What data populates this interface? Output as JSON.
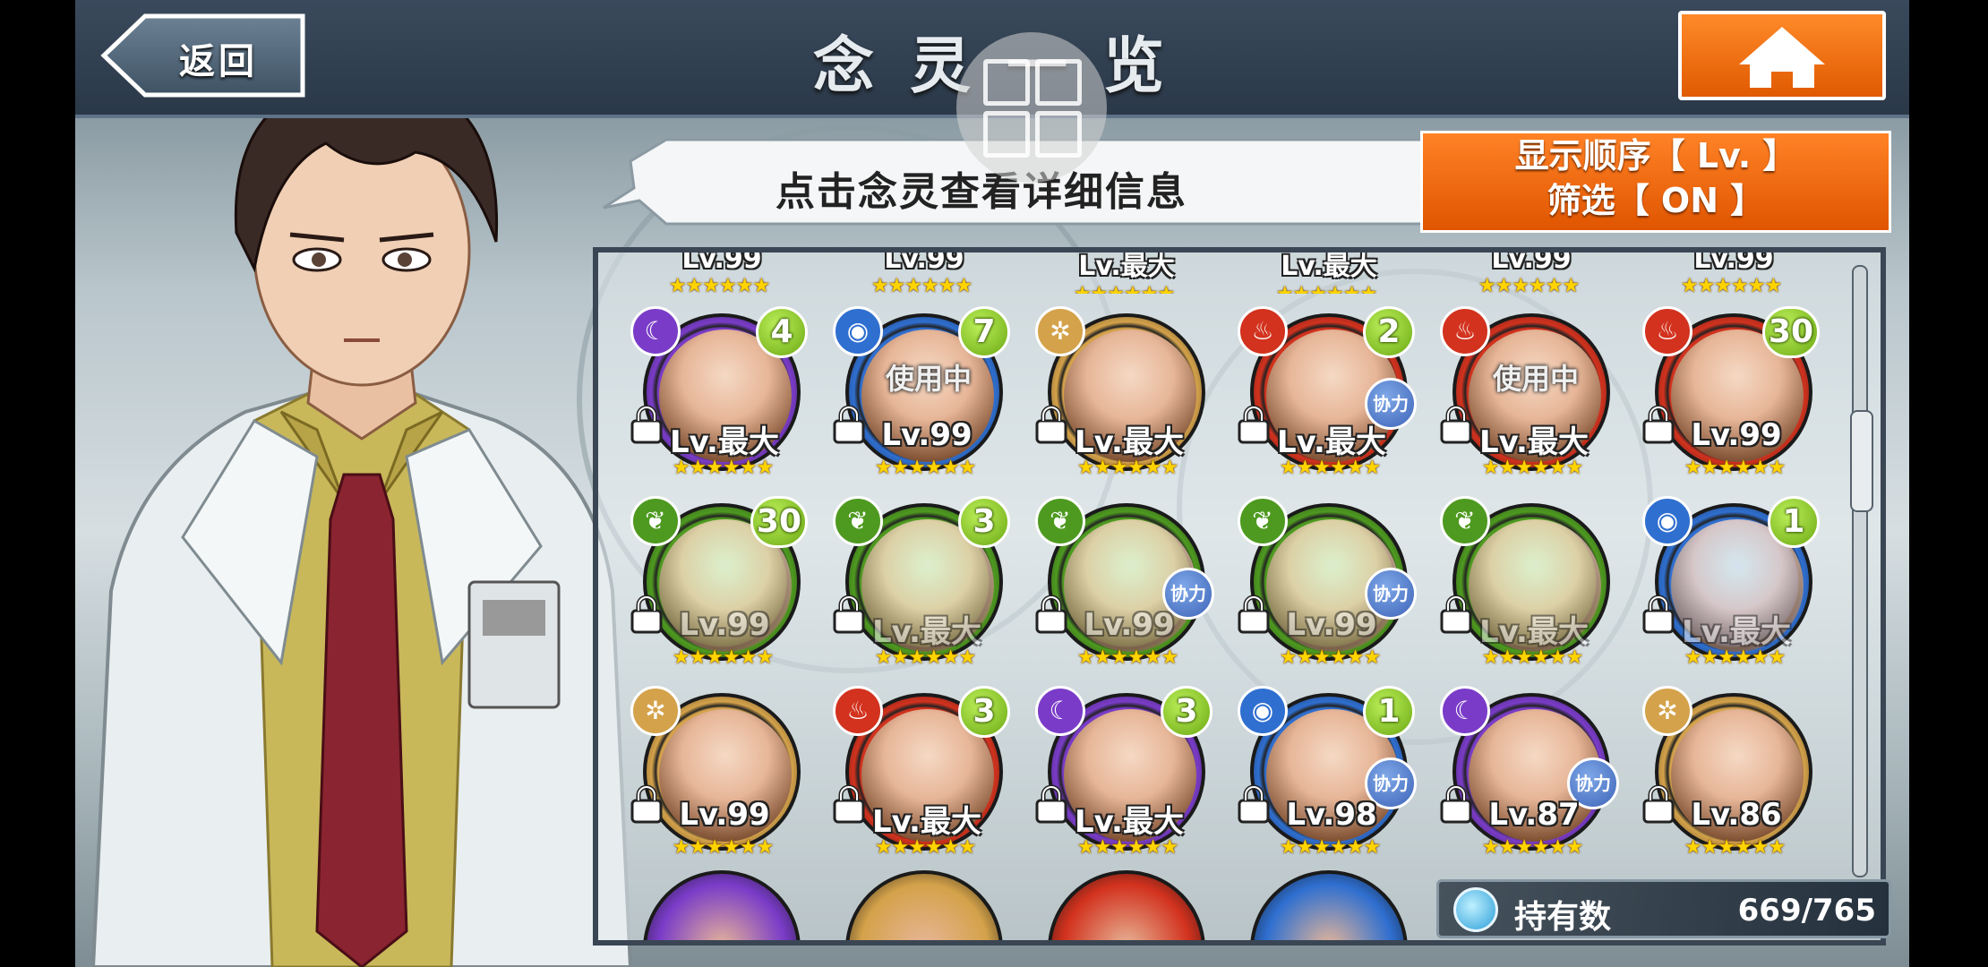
{
  "topbar": {
    "back_label": "返回",
    "title": "念灵一览"
  },
  "hint": "点击念灵查看详细信息",
  "sort_button": {
    "line1": "显示顺序【 Lv. 】",
    "line2": "筛选【 ON 】"
  },
  "owned": {
    "label": "持有数",
    "value": "669/765"
  },
  "colors": {
    "orange": "#e86400",
    "moon": "#7a3cc8",
    "water": "#2f6fd0",
    "light": "#d4a24a",
    "fire": "#d2321e",
    "wood": "#4e9a20",
    "count_badge": "#8ac820"
  },
  "partial_top_row": [
    "Lv.99",
    "Lv.99",
    "Lv.最大",
    "Lv.最大",
    "Lv.99",
    "Lv.99"
  ],
  "rows": [
    [
      {
        "element": "moon",
        "count": "4",
        "level": "Lv.最大",
        "stars": "★★★★★★"
      },
      {
        "element": "water",
        "count": "7",
        "level": "Lv.99",
        "stars": "★★★★★★",
        "status": "使用中"
      },
      {
        "element": "light",
        "level": "Lv.最大",
        "stars": "★★★★★★"
      },
      {
        "element": "fire",
        "count": "2",
        "level": "Lv.最大",
        "stars": "★★★★★★",
        "assist": "协力"
      },
      {
        "element": "fire",
        "level": "Lv.最大",
        "stars": "★★★★★★",
        "status": "使用中"
      },
      {
        "element": "fire",
        "count": "30",
        "level": "Lv.99",
        "stars": "★★★★★★"
      }
    ],
    [
      {
        "element": "wood",
        "count": "30",
        "level": "Lv.99",
        "stars": "★★★★★★",
        "faded": true
      },
      {
        "element": "wood",
        "count": "3",
        "level": "Lv.最大",
        "stars": "★★★★★★",
        "faded": true
      },
      {
        "element": "wood",
        "level": "Lv.99",
        "stars": "★★★★★★",
        "faded": true,
        "assist": "协力"
      },
      {
        "element": "wood",
        "level": "Lv.99",
        "stars": "★★★★★★",
        "faded": true,
        "assist": "协力"
      },
      {
        "element": "wood",
        "level": "Lv.最大",
        "stars": "★★★★★★",
        "faded": true
      },
      {
        "element": "water",
        "count": "1",
        "level": "Lv.最大",
        "stars": "★★★★★★",
        "faded": true
      }
    ],
    [
      {
        "element": "light",
        "level": "Lv.99",
        "stars": "★★★★★★"
      },
      {
        "element": "fire",
        "count": "3",
        "level": "Lv.最大",
        "stars": "★★★★★★"
      },
      {
        "element": "moon",
        "count": "3",
        "level": "Lv.最大",
        "stars": "★★★★★★"
      },
      {
        "element": "water",
        "count": "1",
        "level": "Lv.98",
        "stars": "★★★★★★",
        "assist": "协力"
      },
      {
        "element": "moon",
        "level": "Lv.87",
        "stars": "★★★★★★",
        "assist": "协力"
      },
      {
        "element": "light",
        "level": "Lv.86",
        "stars": "★★★★★★"
      }
    ]
  ],
  "bottom_peek": [
    "moon",
    "light",
    "fire",
    "water"
  ]
}
